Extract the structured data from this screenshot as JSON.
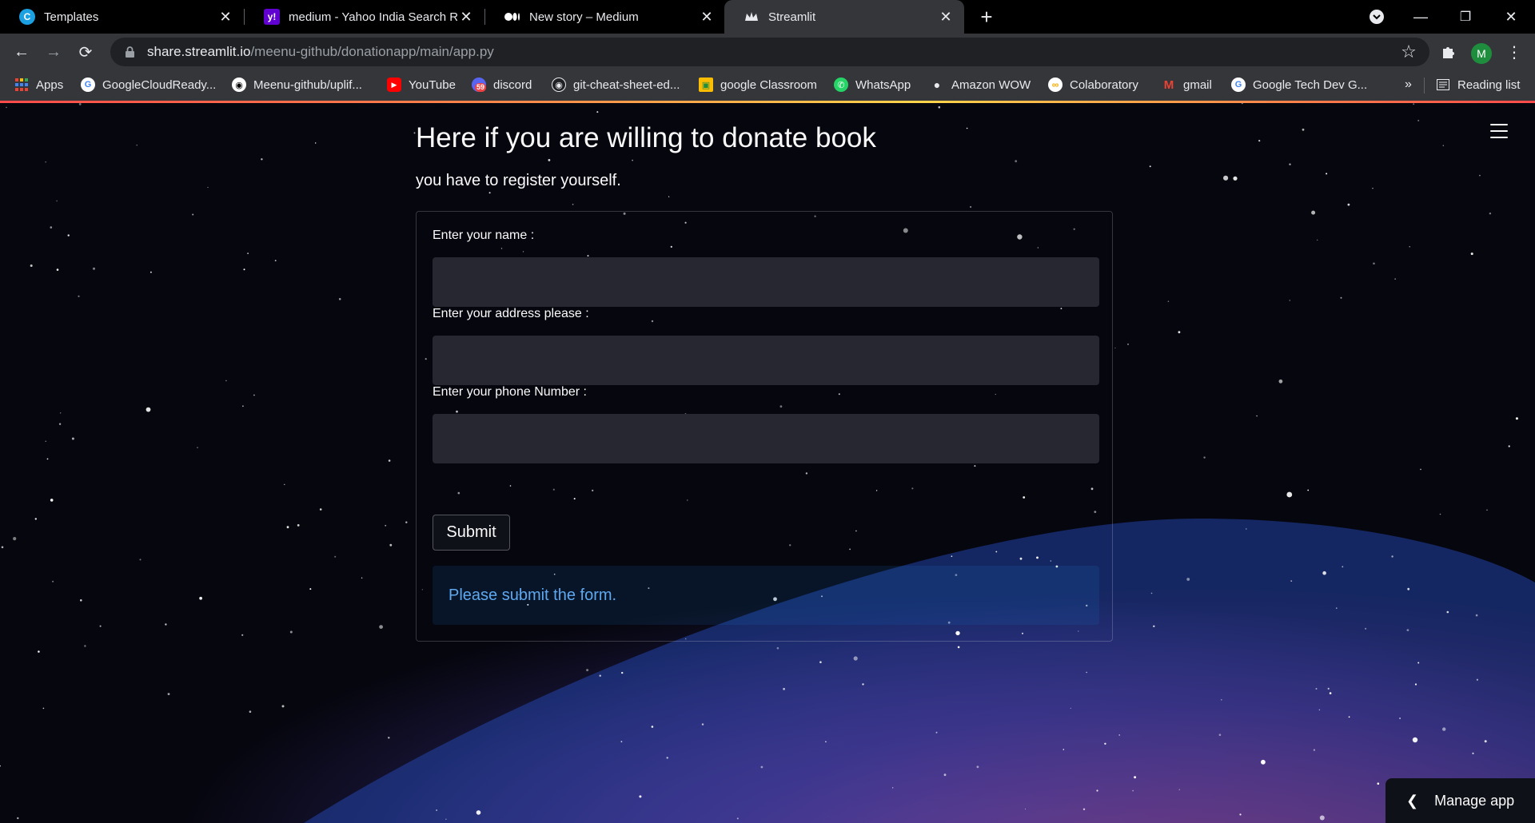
{
  "browser": {
    "tabs": [
      {
        "title": "Templates",
        "icon": "canva-icon",
        "active": false
      },
      {
        "title": "medium - Yahoo India Search Re",
        "icon": "yahoo-icon",
        "active": false
      },
      {
        "title": "New story – Medium",
        "icon": "medium-icon",
        "active": false
      },
      {
        "title": "Streamlit",
        "icon": "streamlit-icon",
        "active": true
      }
    ],
    "url_host": "share.streamlit.io",
    "url_path": "/meenu-github/donationapp/main/app.py",
    "profile_initial": "M",
    "bookmarks": [
      {
        "label": "Apps",
        "icon": "apps-grid-icon"
      },
      {
        "label": "GoogleCloudReady...",
        "icon": "google-icon"
      },
      {
        "label": "Meenu-github/uplif...",
        "icon": "github-icon"
      },
      {
        "label": "YouTube",
        "icon": "youtube-icon"
      },
      {
        "label": "discord",
        "icon": "discord-icon",
        "badge": "59"
      },
      {
        "label": "git-cheat-sheet-ed...",
        "icon": "github-icon"
      },
      {
        "label": "google Classroom",
        "icon": "classroom-icon"
      },
      {
        "label": "WhatsApp",
        "icon": "whatsapp-icon"
      },
      {
        "label": "Amazon WOW",
        "icon": "amazon-icon"
      },
      {
        "label": "Colaboratory",
        "icon": "colab-icon"
      },
      {
        "label": "gmail",
        "icon": "gmail-icon"
      },
      {
        "label": "Google Tech Dev G...",
        "icon": "google-icon"
      }
    ],
    "overflow_label": "»",
    "reading_list_label": "Reading list"
  },
  "app": {
    "heading": "Here if you are willing to donate book",
    "subtext": "you have to register yourself.",
    "form": {
      "fields": [
        {
          "label": "Enter your name :",
          "value": ""
        },
        {
          "label": "Enter your address please :",
          "value": ""
        },
        {
          "label": "Enter your phone Number :",
          "value": ""
        }
      ],
      "submit_label": "Submit",
      "info_message": "Please submit the form."
    },
    "manage_app_label": "Manage app"
  },
  "colors": {
    "accent_info": "#5ea8f0",
    "input_bg": "#262730",
    "loading_bar": "#ff4b4b"
  }
}
